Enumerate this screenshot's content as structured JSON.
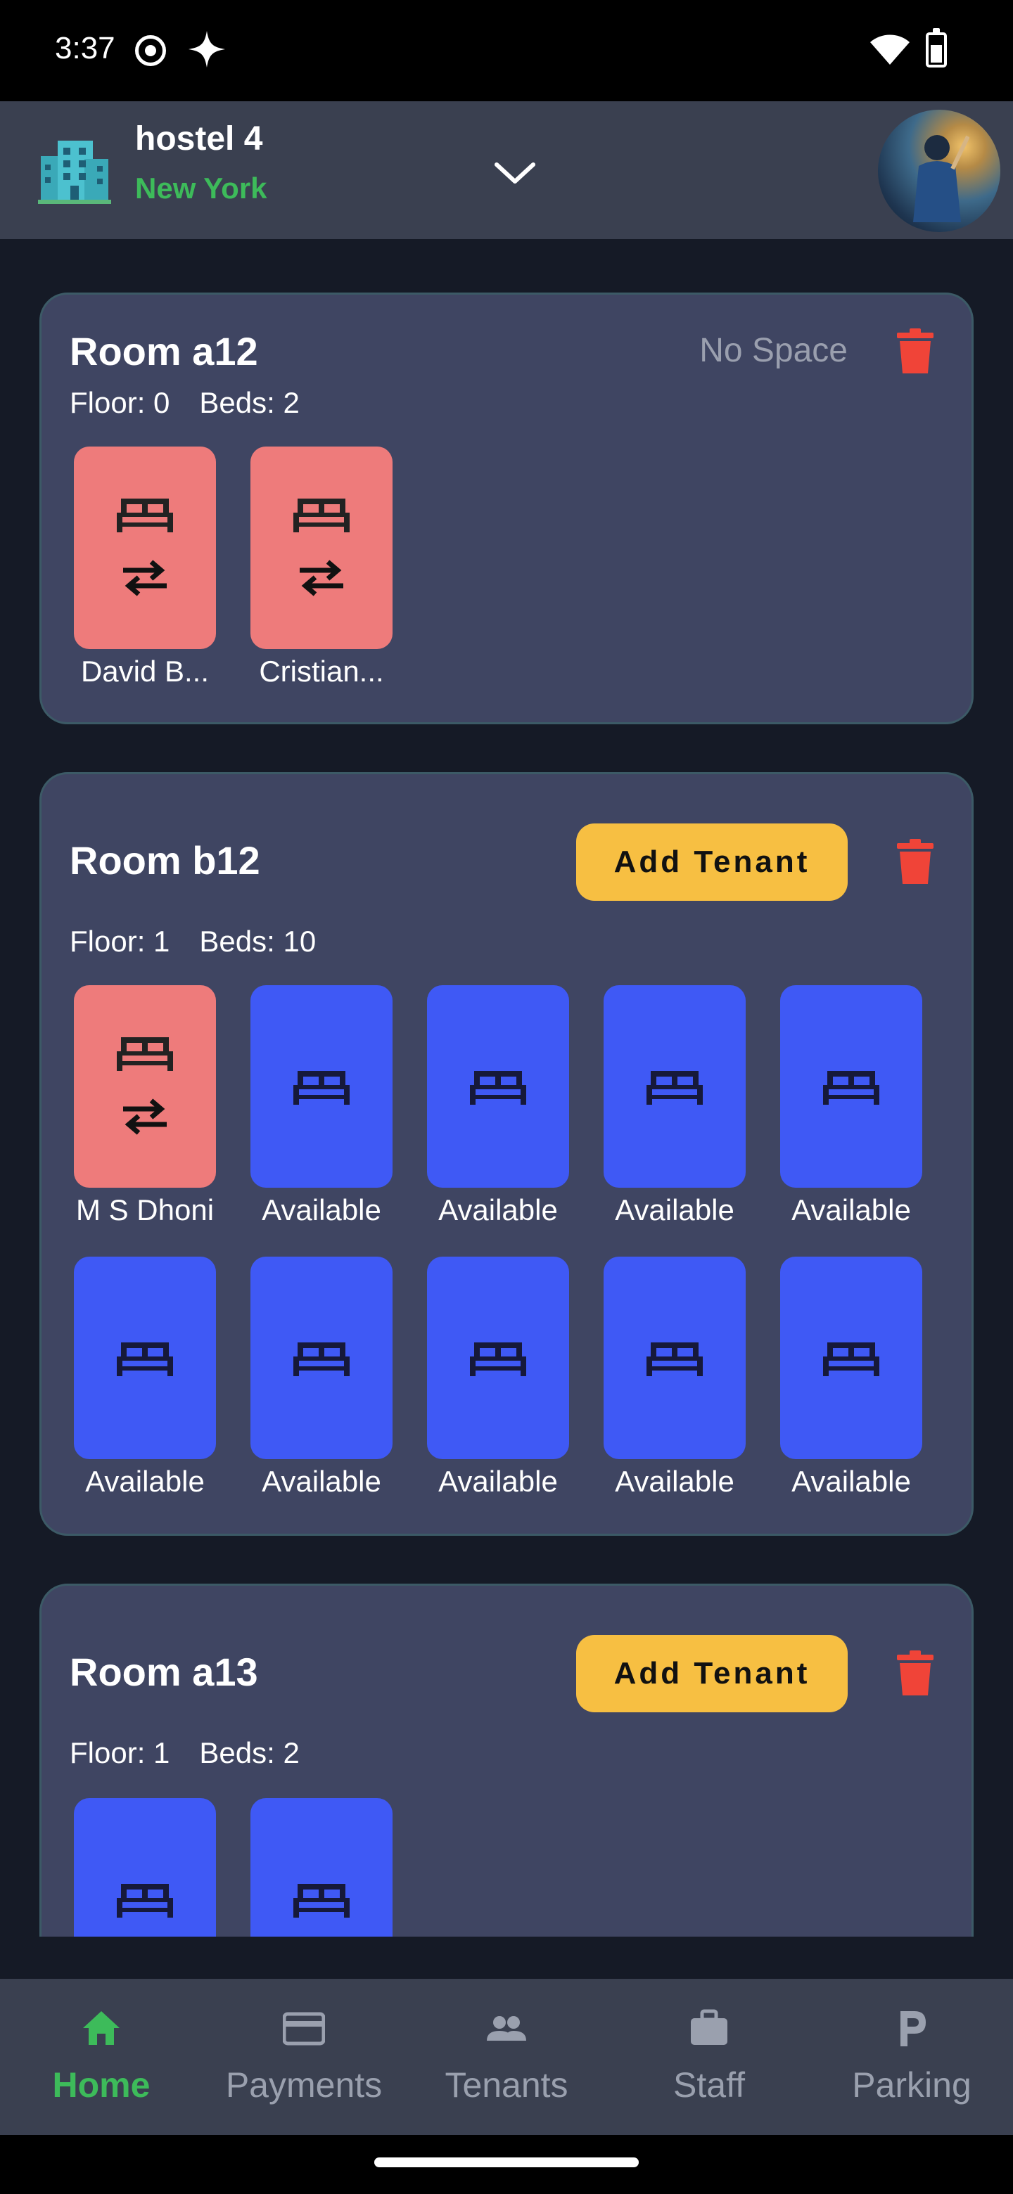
{
  "status_bar": {
    "time": "3:37"
  },
  "header": {
    "hostel_name": "hostel 4",
    "city": "New York"
  },
  "rooms": [
    {
      "title": "Room a12",
      "status": "No Space",
      "floor": "Floor: 0",
      "beds_count": "Beds: 2",
      "beds": [
        {
          "label": "David B...",
          "state": "occupied"
        },
        {
          "label": "Cristian...",
          "state": "occupied"
        }
      ]
    },
    {
      "title": "Room b12",
      "action": "Add Tenant",
      "floor": "Floor: 1",
      "beds_count": "Beds: 10",
      "beds": [
        {
          "label": "M S Dhoni",
          "state": "occupied"
        },
        {
          "label": "Available",
          "state": "available"
        },
        {
          "label": "Available",
          "state": "available"
        },
        {
          "label": "Available",
          "state": "available"
        },
        {
          "label": "Available",
          "state": "available"
        },
        {
          "label": "Available",
          "state": "available"
        },
        {
          "label": "Available",
          "state": "available"
        },
        {
          "label": "Available",
          "state": "available"
        },
        {
          "label": "Available",
          "state": "available"
        },
        {
          "label": "Available",
          "state": "available"
        }
      ]
    },
    {
      "title": "Room a13",
      "action": "Add Tenant",
      "floor": "Floor: 1",
      "beds_count": "Beds: 2",
      "beds": [
        {
          "label": "",
          "state": "available"
        },
        {
          "label": "",
          "state": "available"
        }
      ]
    }
  ],
  "nav": [
    {
      "label": "Home",
      "icon": "home-icon",
      "active": true
    },
    {
      "label": "Payments",
      "icon": "credit-card-icon",
      "active": false
    },
    {
      "label": "Tenants",
      "icon": "people-icon",
      "active": false
    },
    {
      "label": "Staff",
      "icon": "briefcase-icon",
      "active": false
    },
    {
      "label": "Parking",
      "icon": "parking-icon",
      "active": false
    }
  ],
  "colors": {
    "accent_green": "#3dbb5a",
    "occupied": "#ee7b7b",
    "available": "#3f59f5",
    "button": "#f7bf42",
    "delete": "#f04438"
  }
}
